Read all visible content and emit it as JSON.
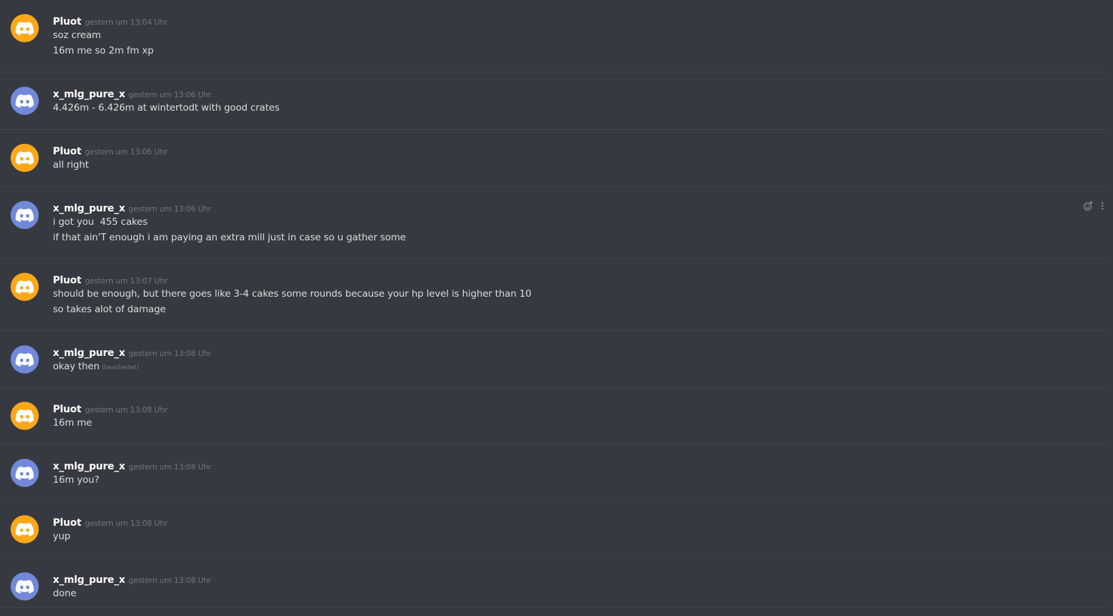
{
  "colors": {
    "background": "#36393f",
    "divider": "#40444b",
    "avatar_orange": "#faa81a",
    "avatar_blurple": "#7289da",
    "username": "#ffffff",
    "text": "#dcddde",
    "muted": "#72767d"
  },
  "messages": [
    {
      "author": "Pluot",
      "avatar_icon": "discord-logo-icon",
      "avatar_color": "#faa81a",
      "timestamp": "gestern um 13:04 Uhr",
      "lines": [
        "soz cream",
        "16m me so 2m fm xp"
      ]
    },
    {
      "author": "x_mlg_pure_x",
      "avatar_icon": "discord-logo-icon",
      "avatar_color": "#7289da",
      "timestamp": "gestern um 13:06 Uhr",
      "lines": [
        "4.426m - 6.426m at wintertodt with good crates"
      ]
    },
    {
      "author": "Pluot",
      "avatar_icon": "discord-logo-icon",
      "avatar_color": "#faa81a",
      "timestamp": "gestern um 13:06 Uhr",
      "lines": [
        "all right"
      ]
    },
    {
      "author": "x_mlg_pure_x",
      "avatar_icon": "discord-logo-icon",
      "avatar_color": "#7289da",
      "timestamp": "gestern um 13:06 Uhr",
      "lines": [
        "i got you  455 cakes",
        "if that ain'T enough i am paying an extra mill just in case so u gather some"
      ],
      "hover_tools": {
        "add_reaction_icon": "add-reaction-icon",
        "more_icon": "more-options-icon"
      }
    },
    {
      "author": "Pluot",
      "avatar_icon": "discord-logo-icon",
      "avatar_color": "#faa81a",
      "timestamp": "gestern um 13:07 Uhr",
      "lines": [
        "should be enough, but there goes like 3-4 cakes some rounds because your hp level is higher than 10",
        "so takes alot of damage"
      ]
    },
    {
      "author": "x_mlg_pure_x",
      "avatar_icon": "discord-logo-icon",
      "avatar_color": "#7289da",
      "timestamp": "gestern um 13:08 Uhr",
      "lines": [
        "okay then"
      ],
      "edited": "(bearbeitet)"
    },
    {
      "author": "Pluot",
      "avatar_icon": "discord-logo-icon",
      "avatar_color": "#faa81a",
      "timestamp": "gestern um 13:08 Uhr",
      "lines": [
        "16m me"
      ]
    },
    {
      "author": "x_mlg_pure_x",
      "avatar_icon": "discord-logo-icon",
      "avatar_color": "#7289da",
      "timestamp": "gestern um 13:08 Uhr",
      "lines": [
        "16m you?"
      ]
    },
    {
      "author": "Pluot",
      "avatar_icon": "discord-logo-icon",
      "avatar_color": "#faa81a",
      "timestamp": "gestern um 13:08 Uhr",
      "lines": [
        "yup"
      ]
    },
    {
      "author": "x_mlg_pure_x",
      "avatar_icon": "discord-logo-icon",
      "avatar_color": "#7289da",
      "timestamp": "gestern um 13:08 Uhr",
      "lines": [
        "done"
      ]
    }
  ]
}
